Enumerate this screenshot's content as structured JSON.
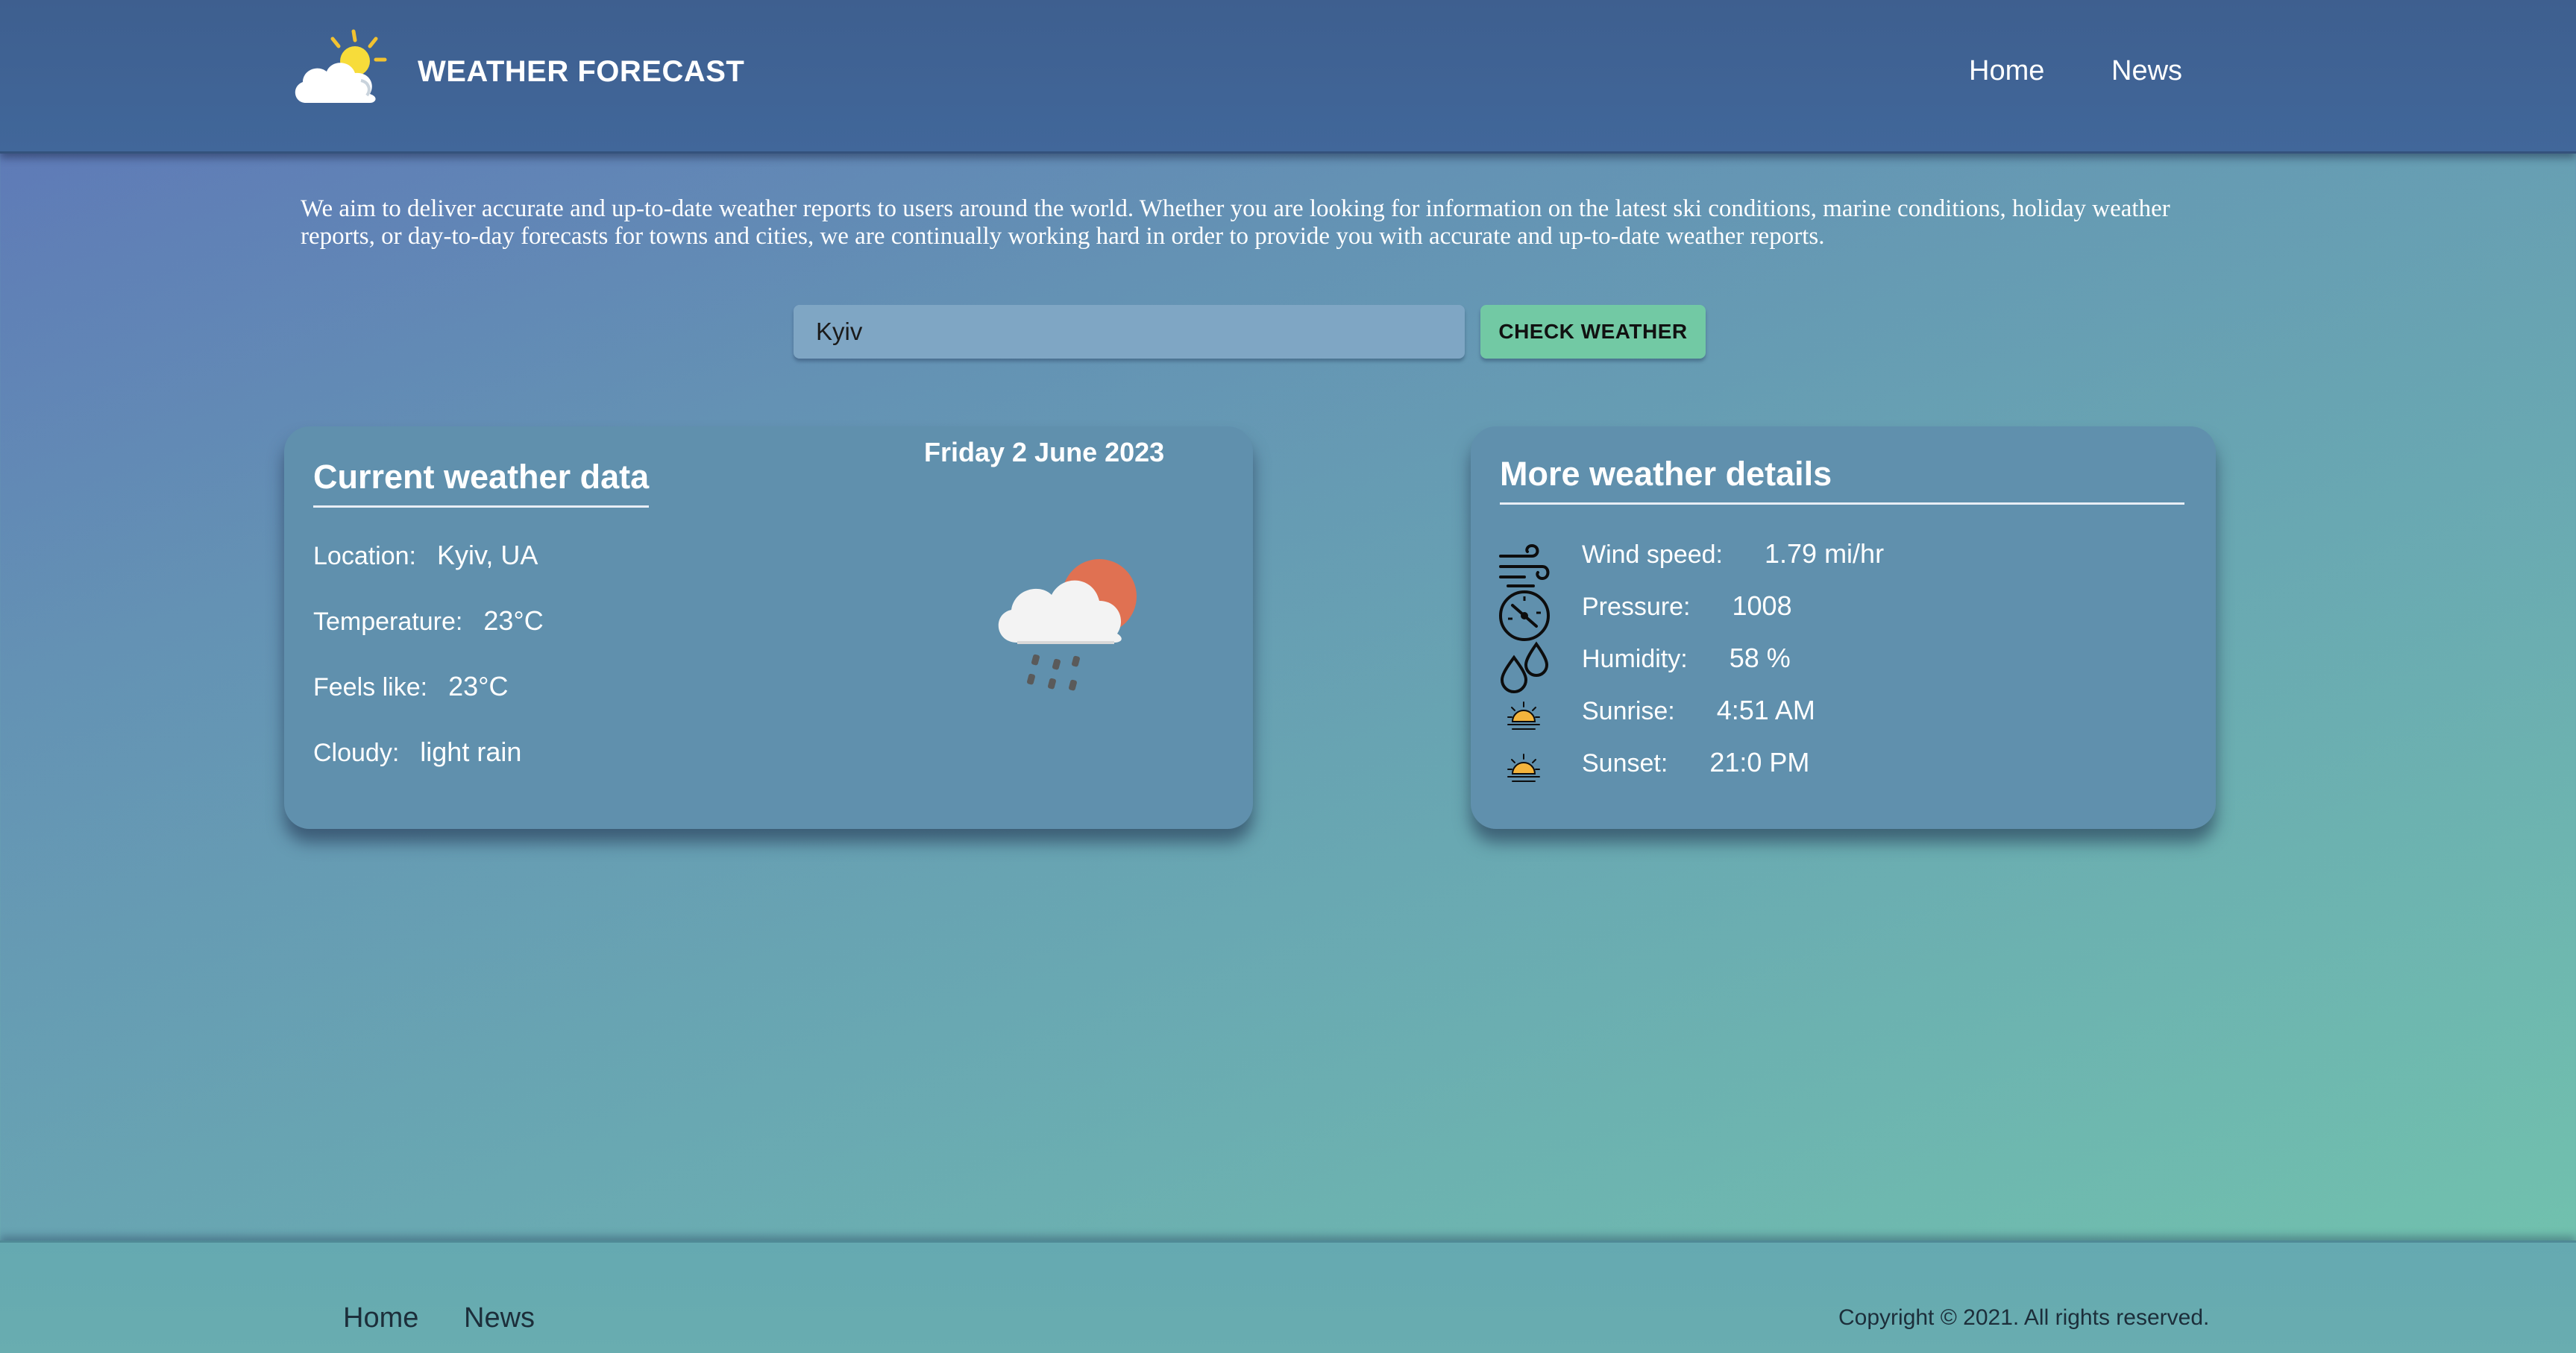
{
  "header": {
    "brand": "WEATHER FORECAST",
    "logo_icon": "sun-cloud-logo-icon",
    "nav": [
      "Home",
      "News"
    ]
  },
  "intro": "We aim to deliver accurate and up-to-date weather reports to users around the world. Whether you are looking for information on the latest ski conditions, marine conditions, holiday weather reports, or day-to-day forecasts for towns and cities, we are continually working hard in order to provide you with accurate and up-to-date weather reports.",
  "search": {
    "value": "Kyiv",
    "button_label": "CHECK WEATHER"
  },
  "current": {
    "title": "Current weather data",
    "date": "Friday 2 June 2023",
    "condition_icon": "light-rain-icon",
    "rows": [
      {
        "label": "Location:",
        "value": "Kyiv, UA"
      },
      {
        "label": "Temperature:",
        "value": "23°C"
      },
      {
        "label": "Feels like:",
        "value": "23°C"
      },
      {
        "label": "Cloudy:",
        "value": "light rain"
      }
    ]
  },
  "details": {
    "title": "More weather details",
    "rows": [
      {
        "icon": "wind-icon",
        "label": "Wind speed:",
        "value": "1.79 mi/hr"
      },
      {
        "icon": "pressure-icon",
        "label": "Pressure:",
        "value": "1008"
      },
      {
        "icon": "humidity-icon",
        "label": "Humidity:",
        "value": "58 %"
      },
      {
        "icon": "sunrise-icon",
        "label": "Sunrise:",
        "value": "4:51 AM"
      },
      {
        "icon": "sunset-icon",
        "label": "Sunset:",
        "value": "21:0 PM"
      }
    ]
  },
  "footer": {
    "nav": [
      "Home",
      "News"
    ],
    "copyright": "Copyright © 2021. All rights reserved."
  },
  "colors": {
    "header": "#41679a",
    "card": "#6090ad",
    "button": "#72c9a4",
    "input": "#7fa6c4"
  }
}
